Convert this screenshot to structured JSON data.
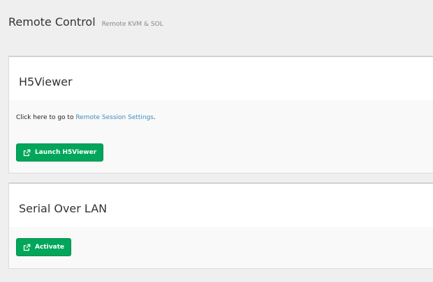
{
  "header": {
    "title": "Remote Control",
    "subtitle": "Remote KVM & SOL"
  },
  "h5viewer": {
    "title": "H5Viewer",
    "help_prefix": "Click here to go to ",
    "help_link": "Remote Session Settings",
    "help_suffix": ".",
    "launch_label": "Launch H5Viewer",
    "launch_icon": "external-link-icon"
  },
  "sol": {
    "title": "Serial Over LAN",
    "activate_label": "Activate",
    "activate_icon": "external-link-icon"
  },
  "colors": {
    "button_green": "#00a65a",
    "link_blue": "#3c8dbc",
    "background": "#efefef"
  }
}
